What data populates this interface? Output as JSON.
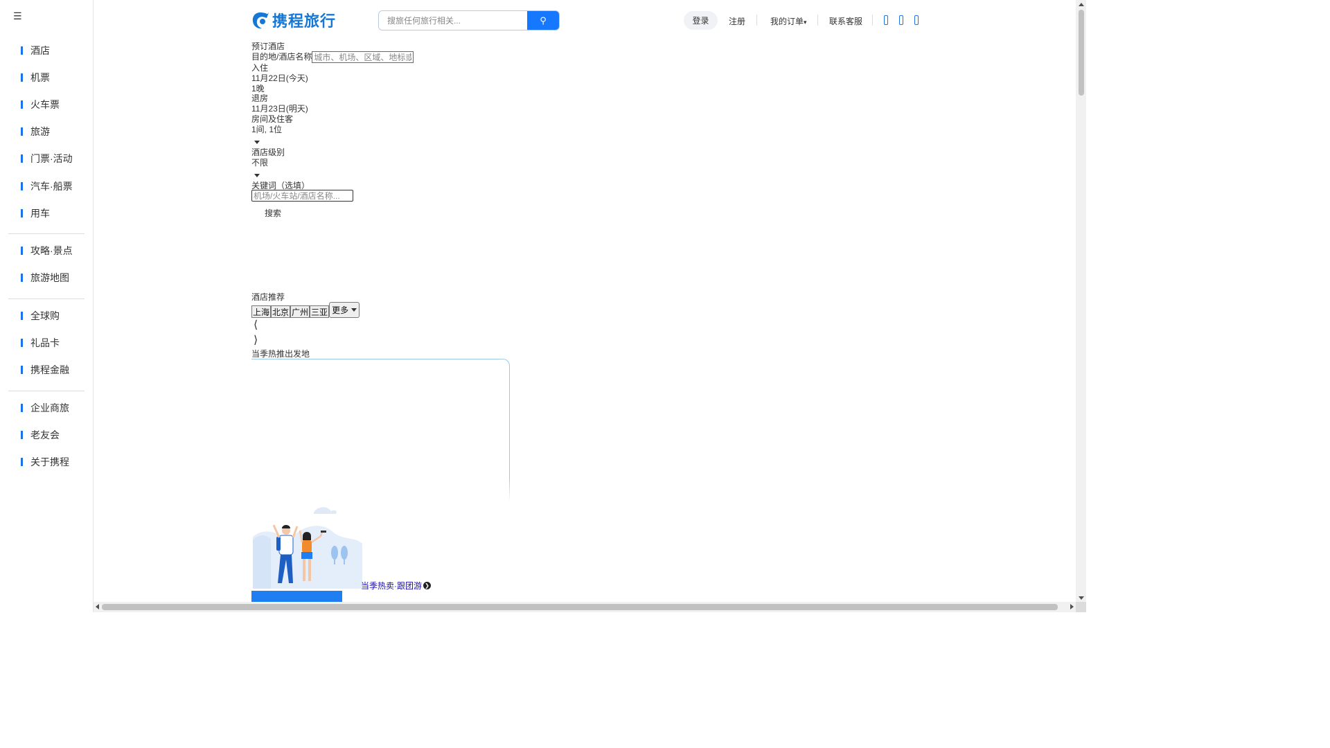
{
  "sidebar": {
    "menu_icon": "menu-icon",
    "group1": [
      {
        "label": "酒店"
      },
      {
        "label": "机票"
      },
      {
        "label": "火车票"
      },
      {
        "label": "旅游"
      },
      {
        "label": "门票·活动"
      },
      {
        "label": "汽车·船票"
      },
      {
        "label": "用车"
      }
    ],
    "group2": [
      {
        "label": "攻略·景点"
      },
      {
        "label": "旅游地图"
      }
    ],
    "group3": [
      {
        "label": "全球购"
      },
      {
        "label": "礼品卡"
      },
      {
        "label": "携程金融"
      }
    ],
    "group4": [
      {
        "label": "企业商旅"
      },
      {
        "label": "老友会"
      },
      {
        "label": "关于携程"
      }
    ]
  },
  "header": {
    "logo_text": "携程旅行",
    "search_placeholder": "搜旅任何旅行相关...",
    "login": "登录",
    "register": "注册",
    "my_orders": "我的订单",
    "customer_service": "联系客服"
  },
  "hotel_search": {
    "title": "预订酒店",
    "dest_label": "目的地/酒店名称",
    "dest_placeholder": "城市、机场、区域、地标或酒店名称",
    "checkin_label": "入住",
    "checkin_date": "11月22日(今天)",
    "nights": "1晚",
    "checkout_label": "退房",
    "checkout_date": "11月23日(明天)",
    "rooms_label": "房间及住客",
    "rooms_value": "1间, 1位",
    "level_label": "酒店级别",
    "level_value": "不限",
    "keyword_label": "关键词（选填）",
    "keyword_placeholder": "机场/火车站/酒店名称...",
    "search_button": "搜索"
  },
  "recommend": {
    "title": "酒店推荐",
    "cities": [
      "上海",
      "北京",
      "广州",
      "三亚"
    ],
    "more": "更多"
  },
  "hot_departure": {
    "title": "当季热推出发地"
  },
  "hot_tour": {
    "link": "当季热卖·跟团游"
  },
  "colors": {
    "brand": "#1677ff",
    "logo": "#1677d4"
  }
}
